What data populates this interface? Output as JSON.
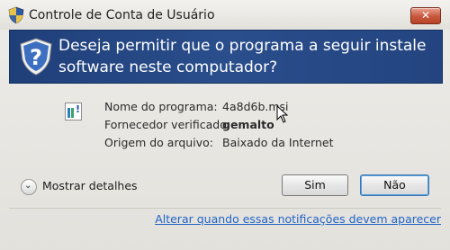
{
  "window": {
    "title": "Controle de Conta de Usuário",
    "close_label": "✕"
  },
  "banner": {
    "message": "Deseja permitir que o programa a seguir instale software neste computador?"
  },
  "program_info": {
    "rows": [
      {
        "label": "Nome do programa:",
        "value": "4a8d6b.msi"
      },
      {
        "label": "Fornecedor verificado:",
        "value": "gemalto"
      },
      {
        "label": "Origem do arquivo:",
        "value": "Baixado da Internet"
      }
    ]
  },
  "details": {
    "label": "Mostrar detalhes"
  },
  "buttons": {
    "yes": "Sim",
    "no": "Não"
  },
  "link": {
    "text": "Alterar quando essas notificações devem aparecer"
  },
  "colors": {
    "banner": "#23447f",
    "link": "#1f63c7",
    "close": "#c8573c"
  }
}
